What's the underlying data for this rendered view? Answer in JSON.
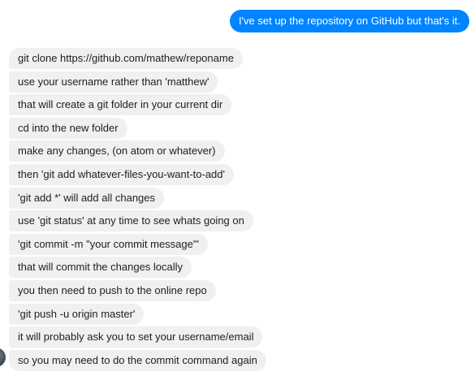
{
  "colors": {
    "sent_bubble": "#0084ff",
    "received_bubble": "#f1f0f0",
    "received_text": "#1c1e21",
    "sent_text": "#ffffff"
  },
  "sent_messages": [
    {
      "text": "I've set up the repository on GitHub but that's it."
    }
  ],
  "received_messages": [
    {
      "text": "git clone https://github.com/mathew/reponame"
    },
    {
      "text": "use your username rather than 'matthew'"
    },
    {
      "text": "that will create a git folder in your current dir"
    },
    {
      "text": "cd into the new folder"
    },
    {
      "text": "make any changes, (on atom or whatever)"
    },
    {
      "text": "then 'git add whatever-files-you-want-to-add'"
    },
    {
      "text": "'git add *' will add all changes"
    },
    {
      "text": "use 'git status' at any time to see whats going on"
    },
    {
      "text": "'git commit -m \"your commit message\"'"
    },
    {
      "text": "that will commit the changes locally"
    },
    {
      "text": "you then need to push to the online repo"
    },
    {
      "text": "'git push -u origin master'"
    },
    {
      "text": "it will probably ask you to set your username/email"
    },
    {
      "text": "so you may need to do the commit command again"
    }
  ],
  "avatar_icon": "contact-avatar-icon"
}
